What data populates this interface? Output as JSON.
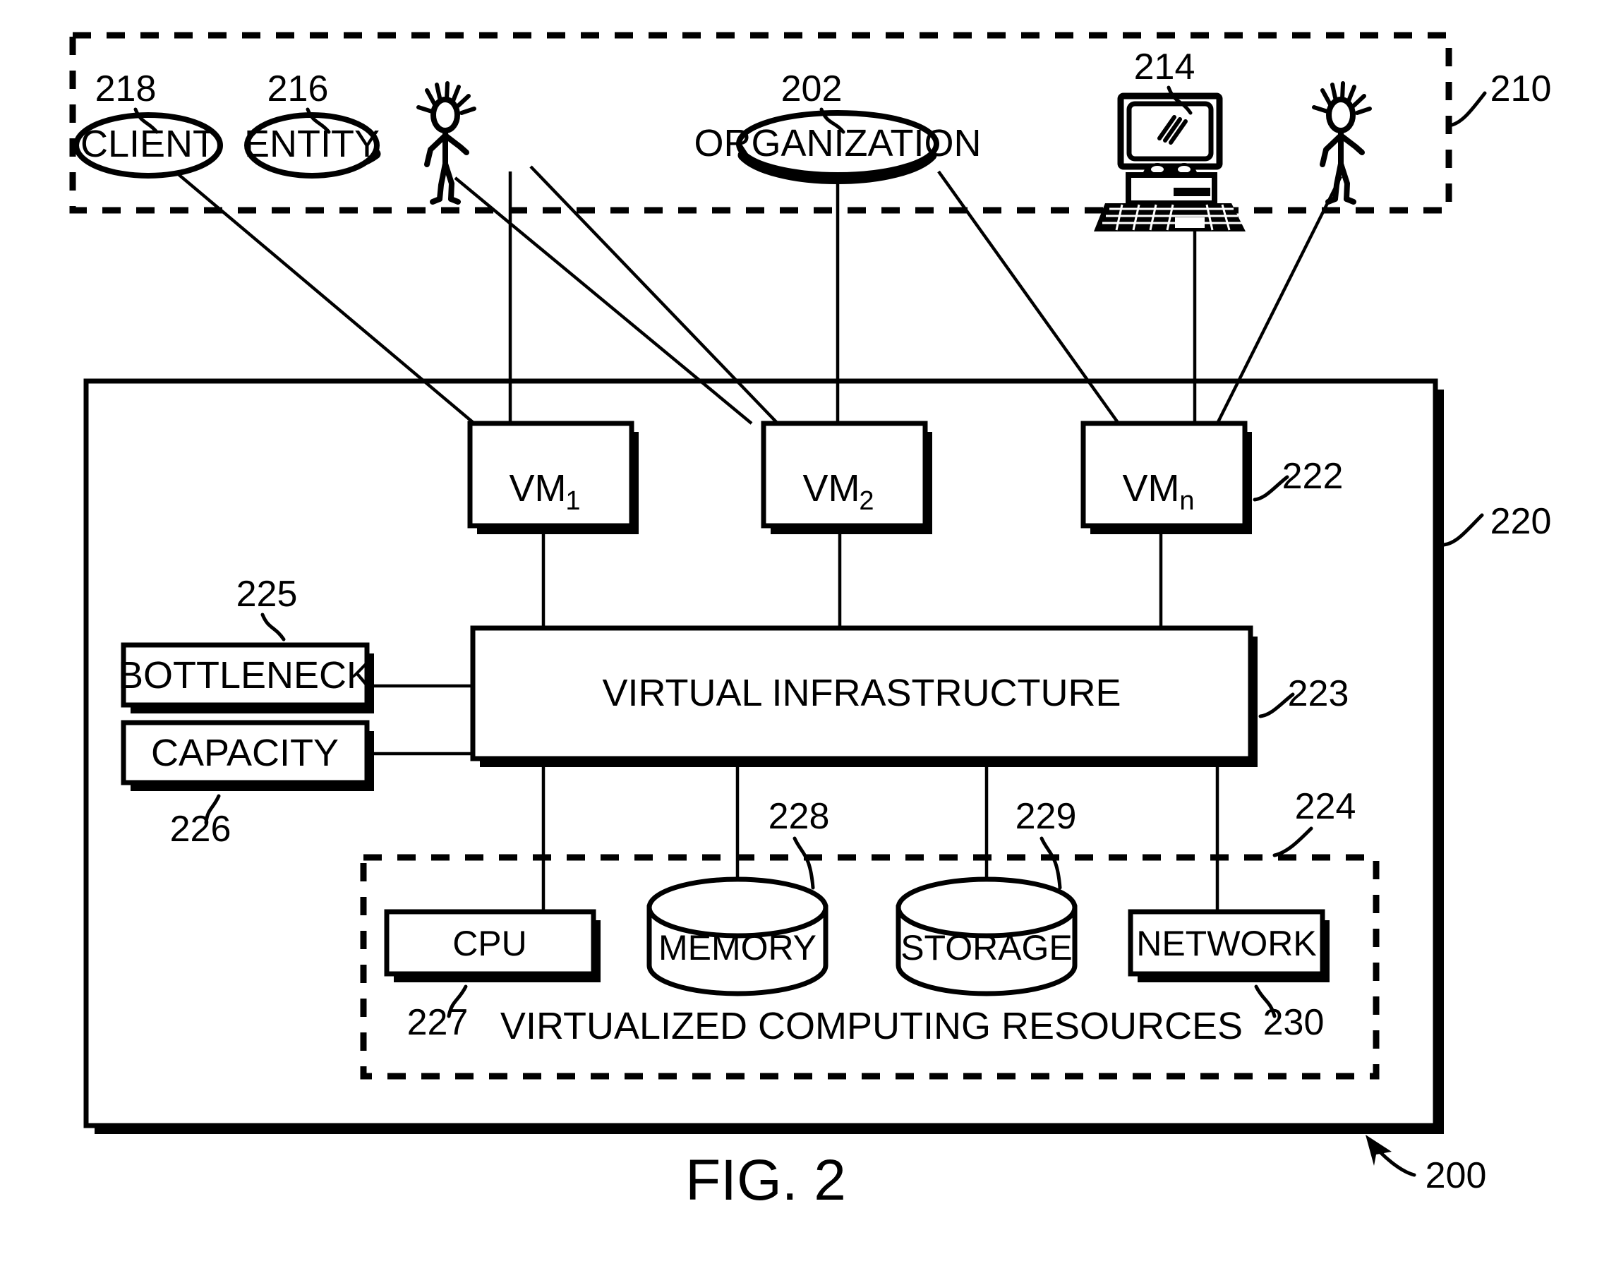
{
  "figure": {
    "caption": "FIG. 2",
    "overall_ref": "200"
  },
  "top_region": {
    "ref": "210",
    "nodes": [
      {
        "id": "client",
        "label": "CLIENT",
        "ref": "218",
        "icon": "ellipse-node"
      },
      {
        "id": "entity",
        "label": "ENTITY",
        "ref": "216",
        "icon": "ellipse-node"
      },
      {
        "id": "person_left",
        "label": "",
        "ref": "",
        "icon": "stick-figure-icon"
      },
      {
        "id": "organization",
        "label": "ORGANIZATION",
        "ref": "202",
        "icon": "ellipse-node"
      },
      {
        "id": "computer",
        "label": "",
        "ref": "214",
        "icon": "desktop-computer-icon"
      },
      {
        "id": "person_right",
        "label": "",
        "ref": "",
        "icon": "stick-figure-icon"
      }
    ]
  },
  "system_region": {
    "ref": "220",
    "vms": [
      {
        "id": "vm1",
        "label": "VM",
        "sub": "1",
        "ref": ""
      },
      {
        "id": "vm2",
        "label": "VM",
        "sub": "2",
        "ref": ""
      },
      {
        "id": "vmn",
        "label": "VM",
        "sub": "n",
        "ref": "222"
      }
    ],
    "side_boxes": [
      {
        "id": "bottleneck",
        "label": "BOTTLENECK",
        "ref": "225"
      },
      {
        "id": "capacity",
        "label": "CAPACITY",
        "ref": "226"
      }
    ],
    "infrastructure": {
      "label": "VIRTUAL INFRASTRUCTURE",
      "ref": "223"
    },
    "resources_group": {
      "label": "VIRTUALIZED COMPUTING RESOURCES",
      "ref": "224",
      "items": [
        {
          "id": "cpu",
          "label": "CPU",
          "ref": "227",
          "shape": "box"
        },
        {
          "id": "memory",
          "label": "MEMORY",
          "ref": "228",
          "shape": "cylinder"
        },
        {
          "id": "storage",
          "label": "STORAGE",
          "ref": "229",
          "shape": "cylinder"
        },
        {
          "id": "network",
          "label": "NETWORK",
          "ref": "230",
          "shape": "box"
        }
      ]
    }
  },
  "colors": {
    "ink": "#000000",
    "paper": "#ffffff"
  }
}
